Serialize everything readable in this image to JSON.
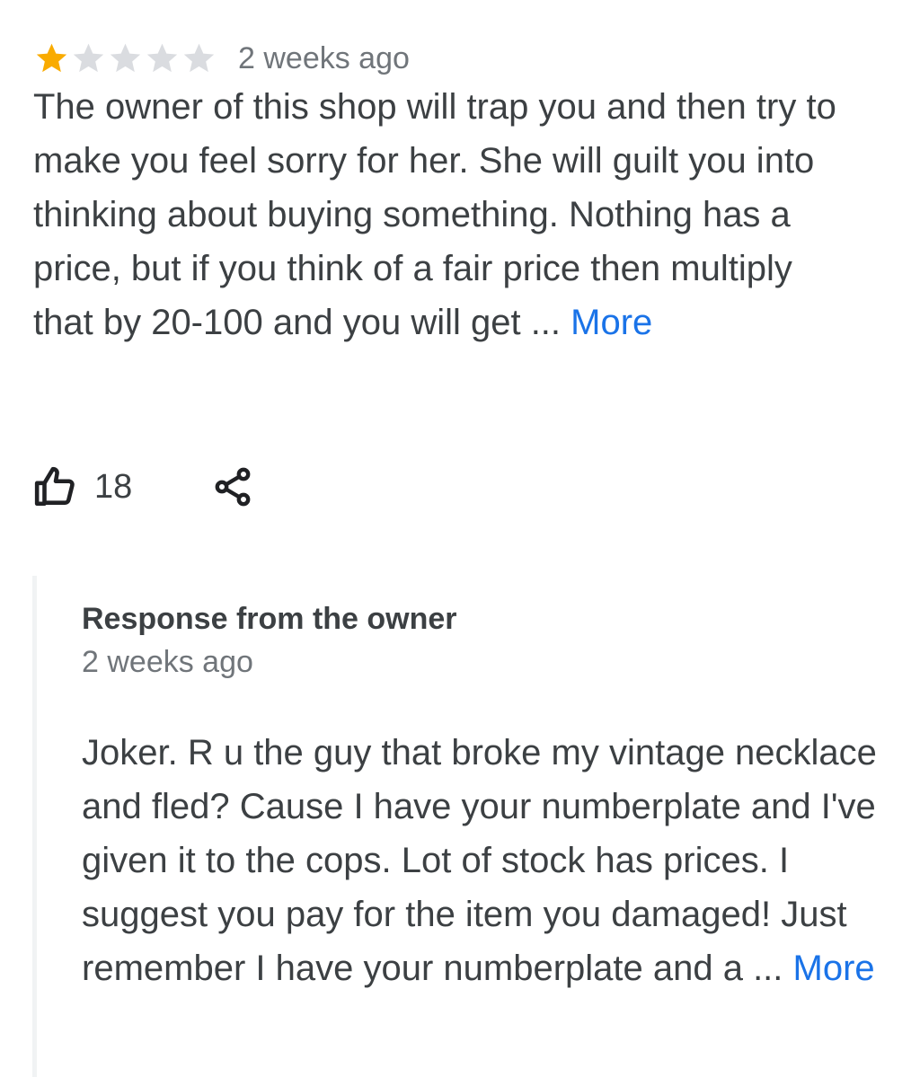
{
  "review": {
    "rating": 1,
    "max_rating": 5,
    "date": "2 weeks ago",
    "text": "The owner of this shop will trap you and then try to make you feel sorry for her. She will guilt you into thinking about buying something. Nothing has a price, but if you think of a fair price then multiply that by 20-100 and you will get ...",
    "more_label": "More",
    "like_count": "18"
  },
  "response": {
    "title": "Response from the owner",
    "date": "2 weeks ago",
    "text": "Joker. R u the guy that broke my vintage necklace and fled? Cause I have your numberplate and I've given it to the cops. Lot of stock has prices. I suggest you pay for the item you damaged! Just remember I have your numberplate and a ...",
    "more_label": "More"
  },
  "icons": {
    "star_filled": "star-filled-icon",
    "star_empty": "star-empty-icon",
    "like": "thumbs-up-icon",
    "share": "share-icon"
  },
  "colors": {
    "star_filled": "#f9ab00",
    "star_empty": "#dadce0",
    "link": "#1a73e8",
    "text": "#3c4043",
    "secondary": "#70757a"
  }
}
